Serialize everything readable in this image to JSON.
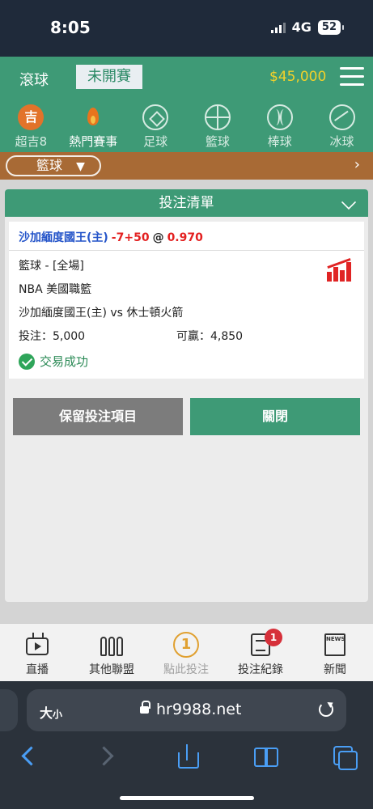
{
  "status_bar": {
    "time": "8:05",
    "network": "4G",
    "battery": "52"
  },
  "header": {
    "live_tab": "滾球",
    "prematch_tab": "未開賽",
    "balance": "$45,000"
  },
  "categories": [
    {
      "label": "超吉8",
      "icon": "kichi-badge-icon",
      "glyph": "吉"
    },
    {
      "label": "熱門賽事",
      "icon": "fire-icon"
    },
    {
      "label": "足球",
      "icon": "soccer-ball-icon"
    },
    {
      "label": "籃球",
      "icon": "basketball-icon"
    },
    {
      "label": "棒球",
      "icon": "baseball-icon"
    },
    {
      "label": "冰球",
      "icon": "hockey-puck-icon"
    }
  ],
  "filter": {
    "selected_sport": "籃球",
    "dropdown_glyph": "▼"
  },
  "bet_slip": {
    "title": "投注清單",
    "selection": {
      "team": "沙加緬度國王(主)",
      "line": "-7+50",
      "at": "@",
      "odds": "0.970"
    },
    "details": {
      "sport_period": "籃球 - [全場]",
      "league": "NBA 美國職籃",
      "matchup": "沙加緬度國王(主) vs 休士頓火箭",
      "stake_label": "投注：5,000",
      "win_label": "可贏：4,850"
    },
    "status": "交易成功",
    "keep_button": "保留投注項目",
    "close_button": "關閉"
  },
  "bottom_nav": [
    {
      "label": "直播",
      "icon": "tv-icon"
    },
    {
      "label": "其他聯盟",
      "icon": "leagues-icon"
    },
    {
      "label": "點此投注",
      "icon": "bet-count-icon",
      "glyph": "1"
    },
    {
      "label": "投注紀錄",
      "icon": "bet-record-icon",
      "badge": "1"
    },
    {
      "label": "新聞",
      "icon": "news-icon",
      "glyph": "NEWS"
    }
  ],
  "browser": {
    "text_size": "大",
    "text_size_small": "小",
    "url": "hr9988.net"
  },
  "colors": {
    "primary_green": "#3e9a76",
    "filter_brown": "#a86a35",
    "balance_yellow": "#f2d12a",
    "odds_red": "#e32020",
    "team_blue": "#2454c9"
  }
}
